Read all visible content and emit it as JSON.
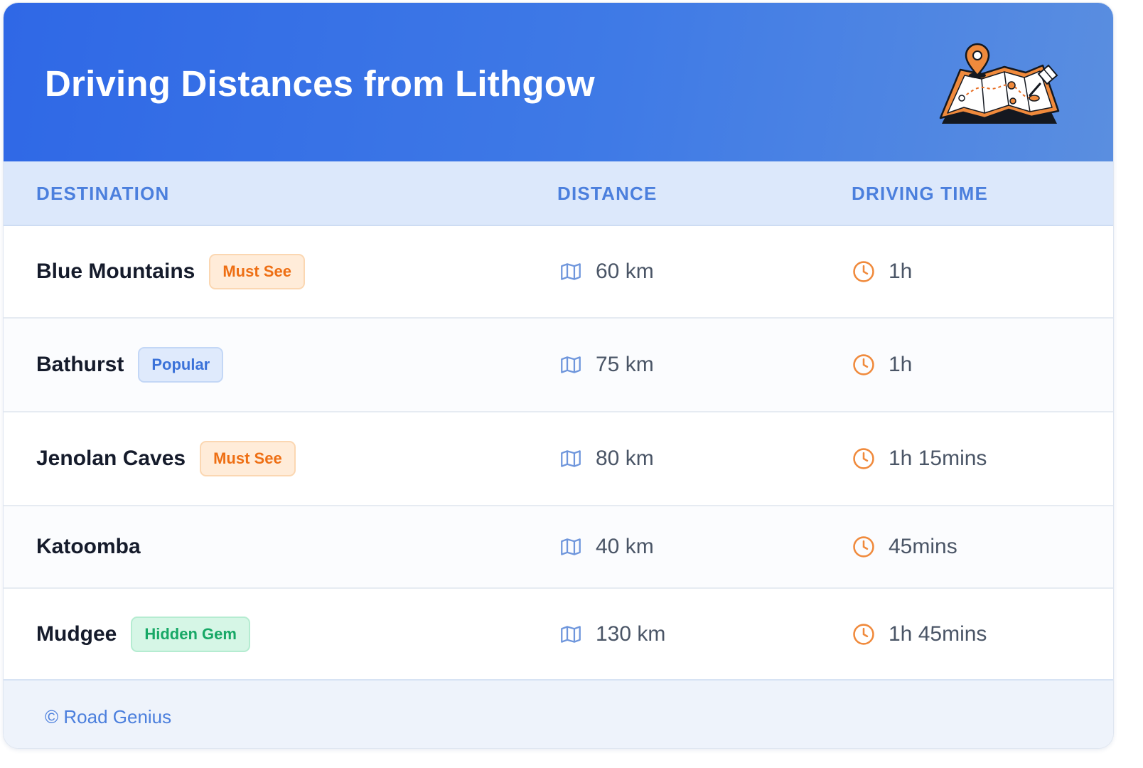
{
  "header": {
    "title": "Driving Distances from Lithgow",
    "illustration": "map-with-pins-icon"
  },
  "table": {
    "columns": [
      "DESTINATION",
      "DISTANCE",
      "DRIVING TIME"
    ],
    "rows": [
      {
        "destination": "Blue Mountains",
        "badge": "Must See",
        "badge_color": "orange",
        "distance": "60 km",
        "time": "1h"
      },
      {
        "destination": "Bathurst",
        "badge": "Popular",
        "badge_color": "blue",
        "distance": "75 km",
        "time": "1h"
      },
      {
        "destination": "Jenolan Caves",
        "badge": "Must See",
        "badge_color": "orange",
        "distance": "80 km",
        "time": "1h 15mins"
      },
      {
        "destination": "Katoomba",
        "badge": "",
        "badge_color": "",
        "distance": "40 km",
        "time": "45mins"
      },
      {
        "destination": "Mudgee",
        "badge": "Hidden Gem",
        "badge_color": "green",
        "distance": "130 km",
        "time": "1h 45mins"
      }
    ]
  },
  "icons": {
    "distance": "map-icon",
    "time": "clock-icon"
  },
  "footer": {
    "text": "© Road Genius"
  },
  "colors": {
    "header_gradient_start": "#2f68e6",
    "header_gradient_end": "#5a8ee0",
    "accent_blue": "#4b7fdd",
    "accent_orange": "#ee6f14",
    "accent_green": "#17a866"
  }
}
